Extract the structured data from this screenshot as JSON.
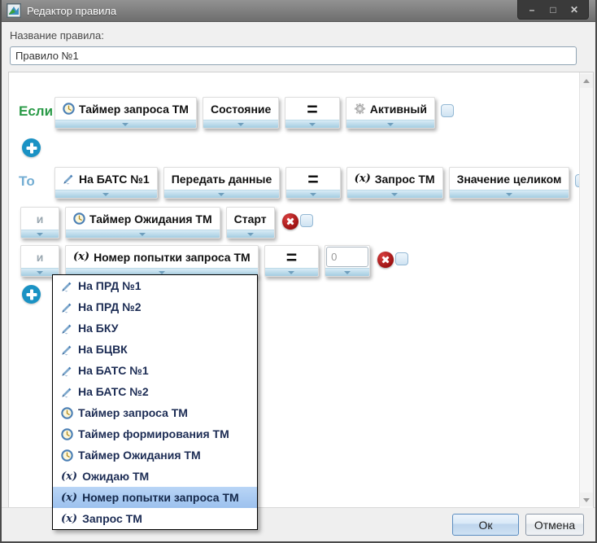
{
  "window": {
    "title": "Редактор правила",
    "controls": {
      "minimize": "–",
      "maximize": "□",
      "close": "✕"
    }
  },
  "form": {
    "name_label": "Название правила:",
    "name_value": "Правило №1"
  },
  "colors": {
    "accent_blue": "#1a92c4",
    "strip_blue": "#a3cce1",
    "if_green": "#2a9a47",
    "then_blue": "#74aed3",
    "delete_red": "#9d1212",
    "selection_blue": "#9cc1ee"
  },
  "rule": {
    "if_label": "Если",
    "then_label": "То",
    "and_label": "и",
    "var_prefix": "(x)",
    "if_row": {
      "blocks": [
        {
          "icon": "clock-icon",
          "label": "Таймер запроса ТМ"
        },
        {
          "label": "Состояние"
        },
        {
          "label": "="
        },
        {
          "icon": "gear-icon",
          "label": "Активный"
        }
      ]
    },
    "then_row": {
      "blocks": [
        {
          "icon": "hand-pen-icon",
          "label": "На БАТС №1"
        },
        {
          "label": "Передать данные"
        },
        {
          "label": "="
        },
        {
          "icon": "x-variable",
          "label": "Запрос ТМ"
        },
        {
          "label": "Значение целиком"
        }
      ]
    },
    "and_rows": [
      {
        "blocks": [
          {
            "icon": "clock-icon",
            "label": "Таймер Ожидания ТМ"
          },
          {
            "label": "Старт"
          }
        ]
      },
      {
        "blocks": [
          {
            "icon": "x-variable",
            "label": "Номер попытки запроса ТМ"
          },
          {
            "label": "="
          }
        ],
        "value_input": "0"
      }
    ]
  },
  "dropdown": {
    "items": [
      {
        "icon": "hand-pen-icon",
        "label": "На ПРД №1"
      },
      {
        "icon": "hand-pen-icon",
        "label": "На ПРД №2"
      },
      {
        "icon": "hand-pen-icon",
        "label": "На БКУ"
      },
      {
        "icon": "hand-pen-icon",
        "label": "На БЦВК"
      },
      {
        "icon": "hand-pen-icon",
        "label": "На БАТС №1"
      },
      {
        "icon": "hand-pen-icon",
        "label": "На БАТС №2"
      },
      {
        "icon": "clock-icon",
        "label": "Таймер запроса ТМ"
      },
      {
        "icon": "clock-icon",
        "label": "Таймер формирования ТМ"
      },
      {
        "icon": "clock-icon",
        "label": "Таймер Ожидания ТМ"
      },
      {
        "icon": "x-variable",
        "label": "Ожидаю ТМ"
      },
      {
        "icon": "x-variable",
        "label": "Номер попытки запроса ТМ",
        "selected": true
      },
      {
        "icon": "x-variable",
        "label": "Запрос ТМ"
      }
    ]
  },
  "footer": {
    "ok_label": "Ок",
    "cancel_label": "Отмена"
  }
}
